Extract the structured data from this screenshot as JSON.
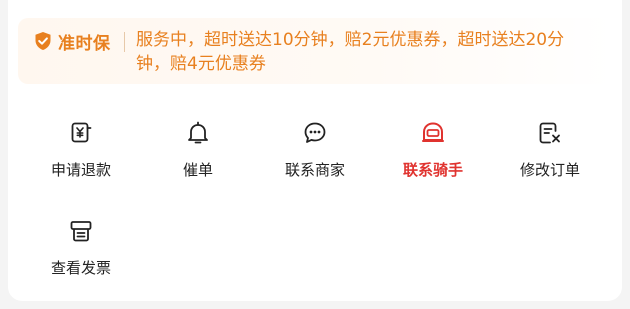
{
  "guarantee": {
    "badge_label": "准时保",
    "description": "服务中，超时送达10分钟，赔2元优惠券，超时送达20分钟，赔4元优惠券"
  },
  "actions": [
    {
      "label": "申请退款",
      "icon": "refund-icon"
    },
    {
      "label": "催单",
      "icon": "bell-icon"
    },
    {
      "label": "联系商家",
      "icon": "chat-store-icon"
    },
    {
      "label": "联系骑手",
      "icon": "rider-helmet-icon",
      "highlighted": true
    },
    {
      "label": "修改订单",
      "icon": "edit-order-icon"
    },
    {
      "label": "查看发票",
      "icon": "invoice-icon"
    }
  ],
  "colors": {
    "accent_orange": "#e8801f",
    "accent_red": "#e0332f",
    "text_dark": "#222222"
  }
}
